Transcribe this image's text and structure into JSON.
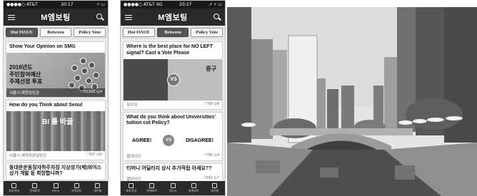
{
  "phone1": {
    "status": {
      "carrier": "●●●●○ AT&T",
      "time": "20:17",
      "battery": "⚡ ▭"
    },
    "app_title": "M엠보팅",
    "tabs": [
      "Hot ISSUE",
      "Between",
      "Policy Vote"
    ],
    "active_tab": 0,
    "card1": {
      "title": "Show Your Opinion on SMG",
      "promo_line1": "2016년도",
      "promo_line2": "주민참여예산",
      "promo_line3": "주제선정 투표",
      "caption_left": "서울시 재정담당관",
      "caption_right": "♡20,592 ◎4"
    },
    "card2": {
      "title": "How do you Think about Seoul",
      "img_text": "BI 를 바꿀",
      "meta_left": "서울시 제작자문담당관",
      "meta_right": "♡507 ◎6"
    },
    "card3": {
      "title": "동대문운동장자하주차장 지상성가(제)외어스 상가 개발 등 희망합니까?"
    },
    "nav": [
      "초보안내",
      "전체보트",
      "카드뉴",
      "지역보트",
      "내주제"
    ]
  },
  "phone2": {
    "status": {
      "carrier": "●●●●○ AT&T 4G",
      "time": "20:27",
      "battery": "↗ ⚡ ▭"
    },
    "app_title": "M엠보팅",
    "tabs": [
      "Hot ISSUE",
      "Between",
      "Policy Vote"
    ],
    "active_tab": 1,
    "card1": {
      "title": "Where is the best place for NO LEFT signal? Cast a Vote Please",
      "vs": "VS",
      "img_right_text": "중구",
      "meta_left": "무이까",
      "meta_right": "♡768 ◎8"
    },
    "card2": {
      "title": "What do you think about Universities' tuition cut Policy?",
      "agree": "AGREE!",
      "vs": "VS",
      "disagree": "DISAGREE!",
      "meta_left": "열대이지",
      "meta_right": "♡759 ◎4"
    },
    "card3": {
      "title": "티머니 어딜러지 상시 추가적립 아세요??",
      "meta_left": "열당이지",
      "meta_right": "♡642 ◎7"
    },
    "nav": [
      "초보안내",
      "전체보트",
      "카드뉴",
      "지역보트",
      "내주제"
    ]
  },
  "photo": {
    "description_icon": "city-stream-photo"
  }
}
